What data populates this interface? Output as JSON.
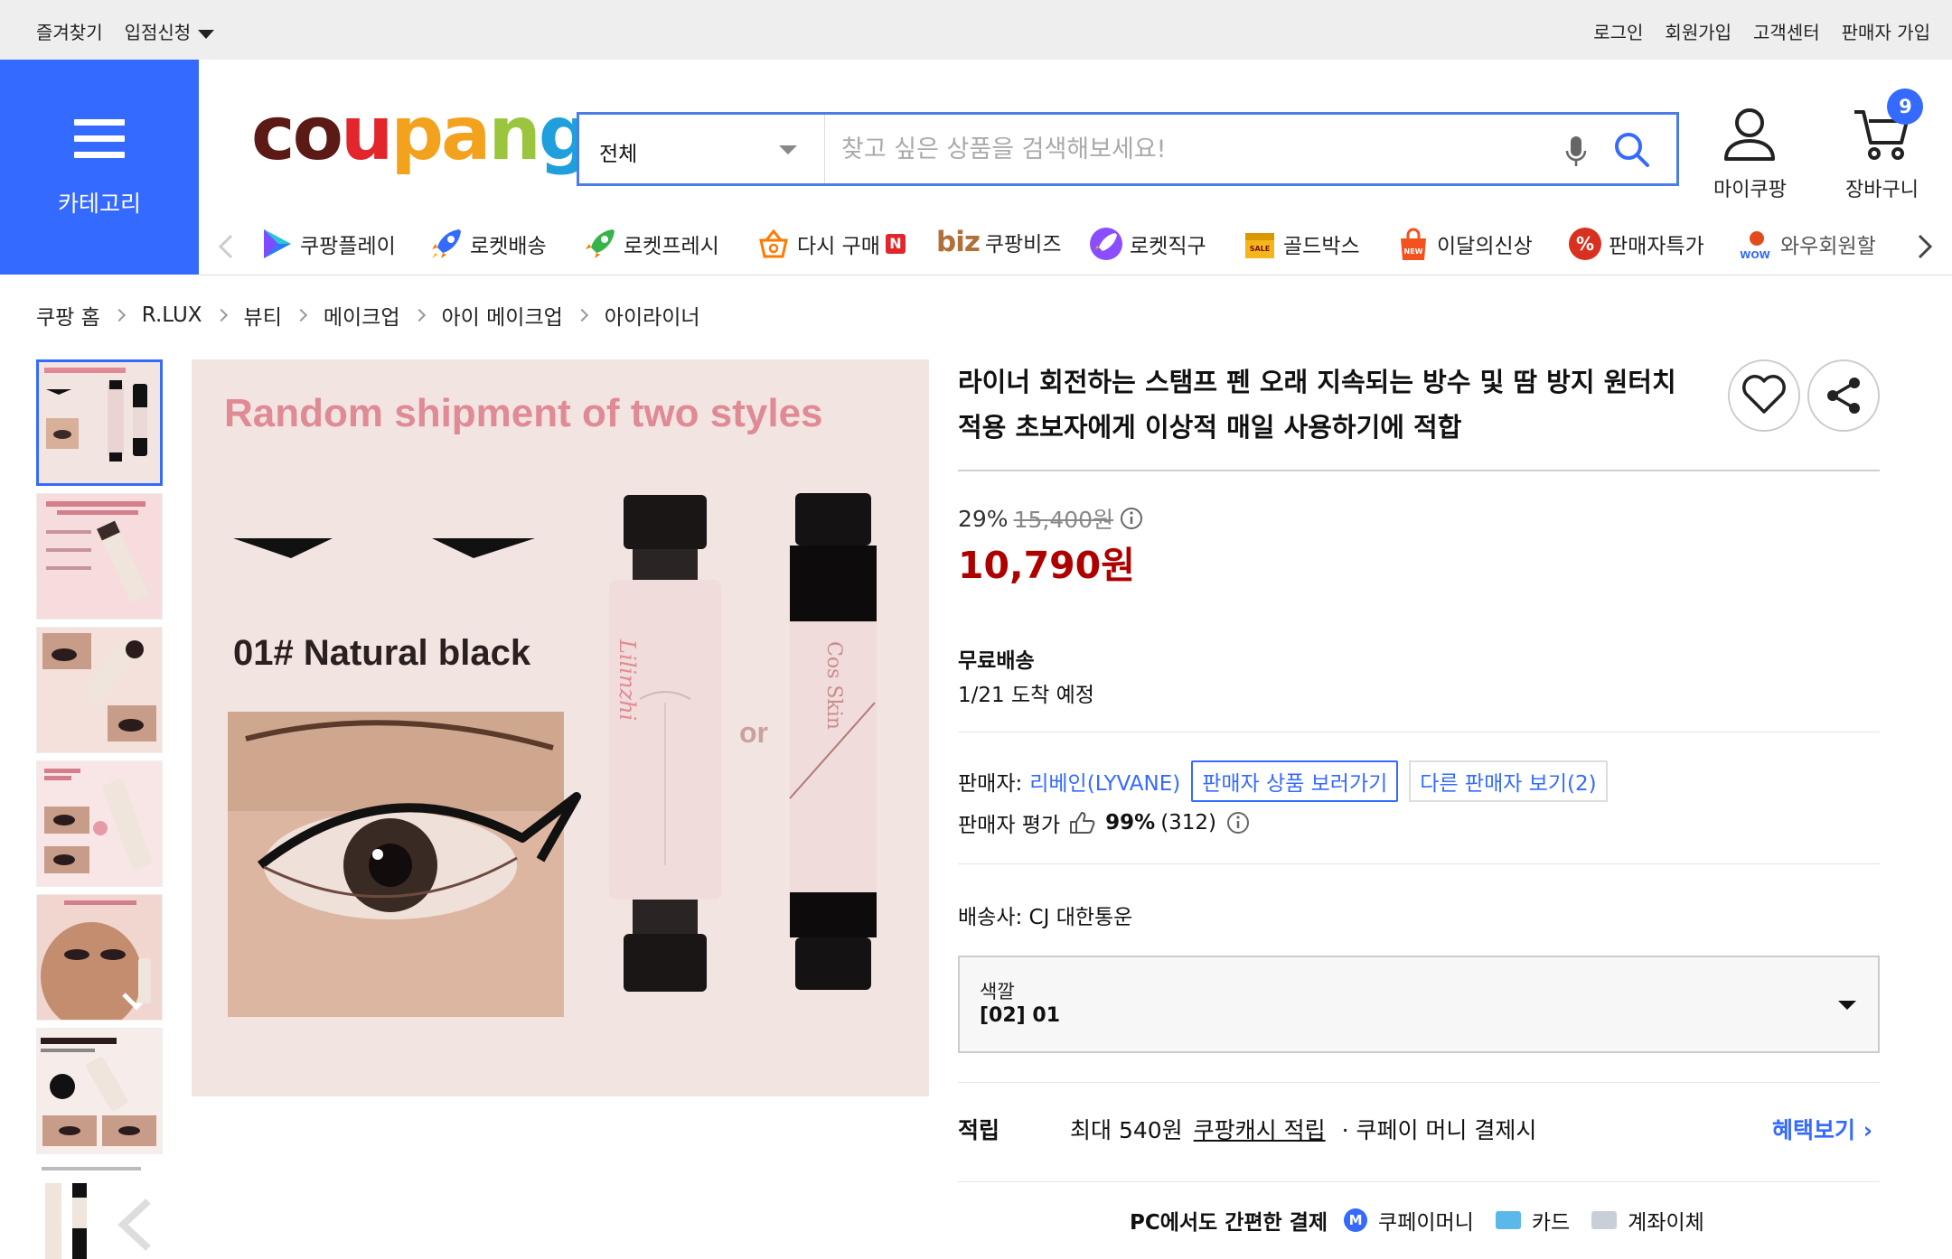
{
  "topbar": {
    "bookmark": "즐겨찾기",
    "seller_apply": "입점신청",
    "login": "로그인",
    "signup": "회원가입",
    "customer_center": "고객센터",
    "seller_signup": "판매자 가입"
  },
  "category_menu": {
    "label": "카테고리"
  },
  "logo_text": "coupang",
  "search": {
    "category": "전체",
    "placeholder": "찾고 싶은 상품을 검색해보세요!"
  },
  "header_icons": {
    "my_coupang": "마이쿠팡",
    "cart": "장바구니",
    "cart_count": "9"
  },
  "service_nav": [
    {
      "label": "쿠팡플레이",
      "icon": "play-icon"
    },
    {
      "label": "로켓배송",
      "icon": "rocket-icon"
    },
    {
      "label": "로켓프레시",
      "icon": "rocket-fresh-icon"
    },
    {
      "label": "다시 구매",
      "icon": "rebuy-basket-icon",
      "badge": "N"
    },
    {
      "label": "쿠팡비즈",
      "icon": "biz-icon",
      "prefix": "biz"
    },
    {
      "label": "로켓직구",
      "icon": "rocket-global-icon"
    },
    {
      "label": "골드박스",
      "icon": "gold-box-icon"
    },
    {
      "label": "이달의신상",
      "icon": "new-bag-icon"
    },
    {
      "label": "판매자특가",
      "icon": "percent-icon"
    },
    {
      "label": "와우회원할",
      "icon": "wow-icon"
    }
  ],
  "breadcrumb": [
    "쿠팡 홈",
    "R.LUX",
    "뷰티",
    "메이크업",
    "아이 메이크업",
    "아이라이너"
  ],
  "product_image": {
    "headline": "Random shipment of two styles",
    "variant": "01# Natural black",
    "or": "or",
    "pen_left_text": "Lilinzhi",
    "pen_right_text": "Cos Skin"
  },
  "product": {
    "title": "라이너 회전하는 스탬프 펜 오래 지속되는 방수 및 땀 방지 원터치 적용 초보자에게 이상적 매일 사용하기에 적합",
    "discount_rate": "29%",
    "original_price": "15,400원",
    "price": "10,790원"
  },
  "shipping": {
    "label": "무료배송",
    "arrival": "1/21 도착 예정"
  },
  "seller": {
    "label": "판매자:",
    "name": "리베인(LYVANE)",
    "view_products": "판매자 상품 보러가기",
    "other_sellers": "다른 판매자 보기(2)",
    "rating_label": "판매자 평가",
    "rating_pct": "99%",
    "rating_count": "(312)"
  },
  "carrier": "배송사:  CJ 대한통운",
  "option": {
    "label": "색깔",
    "value": "[02] 01"
  },
  "reward": {
    "label": "적립",
    "text_before": "최대 540원",
    "link": "쿠팡캐시 적립",
    "text_after": "· 쿠페이 머니 결제시",
    "more": "혜택보기"
  },
  "payment": {
    "headline": "PC에서도 간편한 결제",
    "coupay": "쿠페이머니",
    "card": "카드",
    "bank": "계좌이체"
  },
  "colors": {
    "brand_blue": "#346aff",
    "price_red": "#ae0000"
  }
}
